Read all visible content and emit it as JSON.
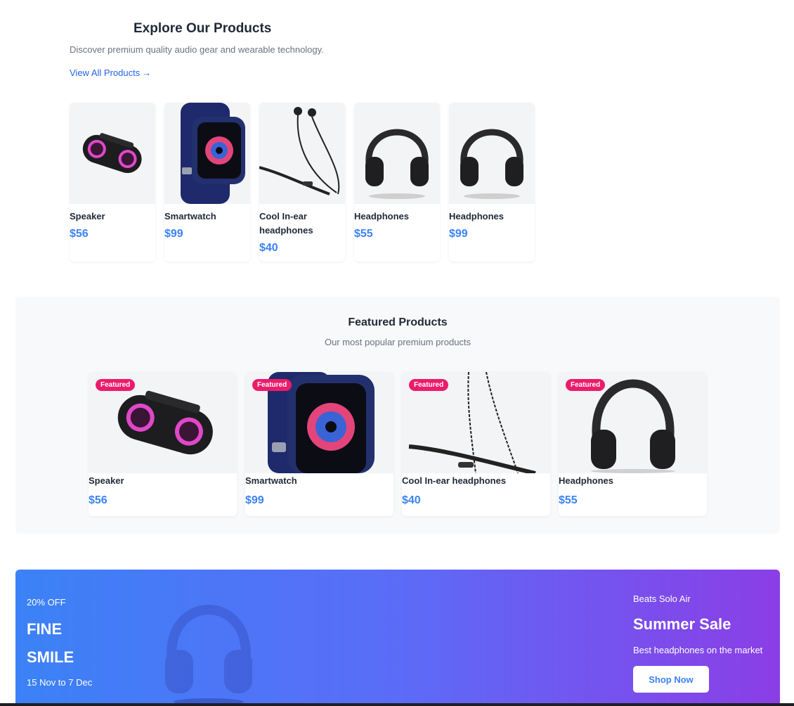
{
  "explore": {
    "title": "Explore Our Products",
    "subtitle": "Discover premium quality audio gear and wearable technology.",
    "view_all": "View All Products",
    "view_all_arrow": "→",
    "products": [
      {
        "name": "Speaker",
        "price": "$56",
        "icon": "speaker-image"
      },
      {
        "name": "Smartwatch",
        "price": "$99",
        "icon": "smartwatch-image"
      },
      {
        "name": "Cool In-ear headphones",
        "price": "$40",
        "icon": "earphones-image"
      },
      {
        "name": "Headphones",
        "price": "$55",
        "icon": "headphones-image"
      },
      {
        "name": "Headphones",
        "price": "$99",
        "icon": "headphones-image"
      }
    ]
  },
  "featured": {
    "title": "Featured Products",
    "subtitle": "Our most popular premium products",
    "badge": "Featured",
    "products": [
      {
        "name": "Speaker",
        "price": "$56",
        "icon": "speaker-image"
      },
      {
        "name": "Smartwatch",
        "price": "$99",
        "icon": "smartwatch-image"
      },
      {
        "name": "Cool In-ear headphones",
        "price": "$40",
        "icon": "earphones-image"
      },
      {
        "name": "Headphones",
        "price": "$55",
        "icon": "headphones-image"
      }
    ]
  },
  "banner": {
    "discount": "20% OFF",
    "line1": "FINE",
    "line2": "SMILE",
    "dates": "15 Nov to 7 Dec",
    "brand": "Beats Solo Air",
    "title": "Summer Sale",
    "description": "Best headphones on the market",
    "button": "Shop Now"
  },
  "colors": {
    "accent": "#3b82f6",
    "badge": "#ec1c6b",
    "banner_start": "#3b82f6",
    "banner_end": "#8b3ee6"
  }
}
